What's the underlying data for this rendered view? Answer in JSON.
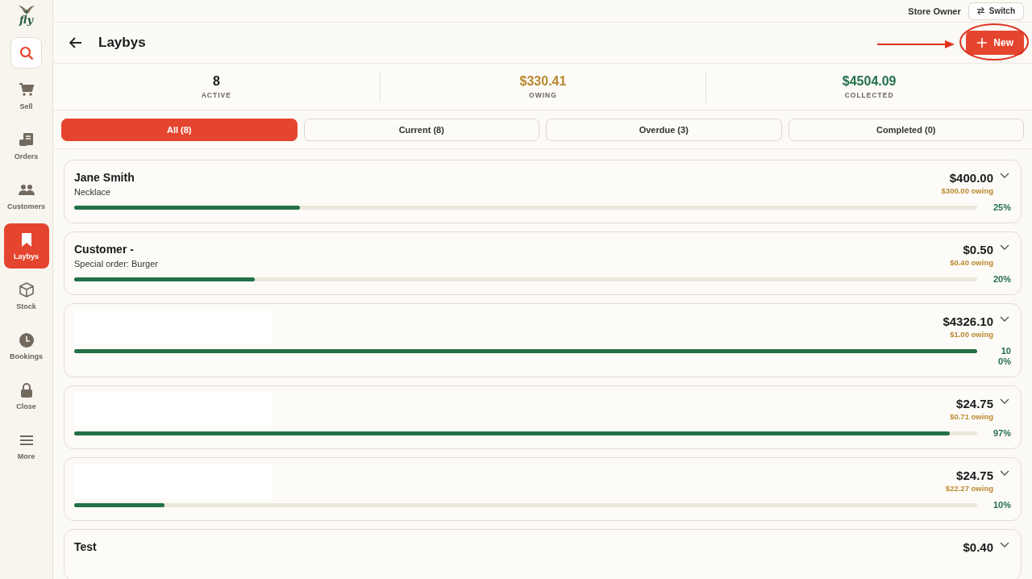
{
  "sidebar": {
    "logo": "fly",
    "items": [
      {
        "label": "Sell",
        "selected": false
      },
      {
        "label": "Orders",
        "selected": false
      },
      {
        "label": "Customers",
        "selected": false
      },
      {
        "label": "Laybys",
        "selected": true
      },
      {
        "label": "Stock",
        "selected": false
      },
      {
        "label": "Bookings",
        "selected": false
      },
      {
        "label": "Close",
        "selected": false
      },
      {
        "label": "More",
        "selected": false
      }
    ]
  },
  "top_bar": {
    "user": "Store Owner",
    "switch_button": "Switch"
  },
  "header": {
    "title": "Laybys",
    "new_button": "New"
  },
  "stats": [
    {
      "value": "8",
      "label": "ACTIVE",
      "color": "#1a1a1a"
    },
    {
      "value": "$330.41",
      "label": "OWING",
      "color": "#b8892f"
    },
    {
      "value": "$4504.09",
      "label": "COLLECTED",
      "color": "#247048"
    }
  ],
  "tabs": [
    {
      "label": "All (8)",
      "selected": true
    },
    {
      "label": "Current (8)",
      "selected": false
    },
    {
      "label": "Overdue (3)",
      "selected": false
    },
    {
      "label": "Completed (0)",
      "selected": false
    }
  ],
  "laybys": [
    {
      "name": "Jane Smith",
      "item": "Necklace",
      "total": "$400.00",
      "owing": "$300.00 owing",
      "level": 0.25,
      "percent": "25%"
    },
    {
      "name": "Customer -",
      "item": "Special order: Burger",
      "total": "$0.50",
      "owing": "$0.40 owing",
      "level": 0.2,
      "percent": "20%"
    },
    {
      "redacted": true,
      "total": "$4326.10",
      "owing": "$1.00 owing",
      "level": 1,
      "percent": "100%"
    },
    {
      "redacted": true,
      "total": "$24.75",
      "owing": "$0.71 owing",
      "level": 0.97,
      "percent": "97%"
    },
    {
      "redacted": true,
      "total": "$24.75",
      "owing": "$22.27 owing",
      "level": 0.1,
      "percent": "10%"
    },
    {
      "name": "Test",
      "total": "$0.40"
    }
  ]
}
